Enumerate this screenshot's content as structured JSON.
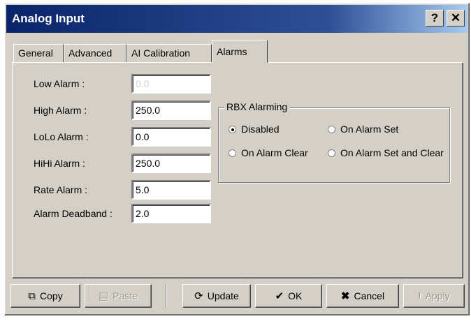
{
  "window": {
    "title": "Analog Input",
    "help_glyph": "?",
    "close_glyph": "✕"
  },
  "tabs": [
    {
      "label": "General",
      "active": false
    },
    {
      "label": "Advanced",
      "active": false
    },
    {
      "label": "AI Calibration",
      "active": false
    },
    {
      "label": "Alarms",
      "active": true
    }
  ],
  "fields": {
    "low_alarm": {
      "label": "Low Alarm :",
      "value": "0.0"
    },
    "high_alarm": {
      "label": "High Alarm :",
      "value": "250.0"
    },
    "lolo_alarm": {
      "label": "LoLo Alarm :",
      "value": "0.0"
    },
    "hihi_alarm": {
      "label": "HiHi Alarm :",
      "value": "250.0"
    },
    "rate_alarm": {
      "label": "Rate Alarm :",
      "value": "5.0"
    },
    "alarm_deadband": {
      "label": "Alarm Deadband :",
      "value": "2.0"
    }
  },
  "rbx": {
    "group_label": "RBX Alarming",
    "options": [
      {
        "label": "Disabled",
        "checked": true
      },
      {
        "label": "On Alarm Set",
        "checked": false
      },
      {
        "label": "On Alarm Clear",
        "checked": false
      },
      {
        "label": "On Alarm Set and Clear",
        "checked": false
      }
    ]
  },
  "buttons": {
    "copy": "Copy",
    "paste": "Paste",
    "update": "Update",
    "ok": "OK",
    "cancel": "Cancel",
    "apply": "Apply"
  },
  "icons": {
    "copy": "copy-icon",
    "paste": "paste-icon",
    "update": "update-icon",
    "ok": "checkmark-icon",
    "cancel": "x-icon",
    "apply": "exclamation-icon"
  },
  "colors": {
    "titlebar_start": "#0a246a",
    "titlebar_end": "#a6caf0",
    "face": "#d4d0c8"
  }
}
